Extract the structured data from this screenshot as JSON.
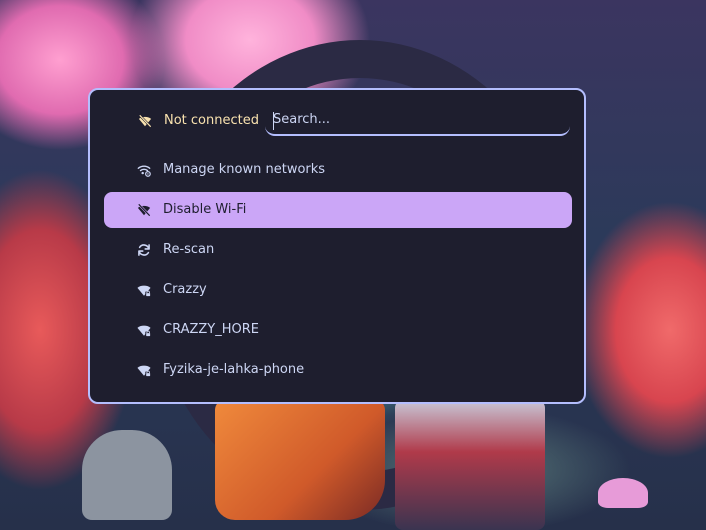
{
  "status": {
    "icon": "wifi-off-icon",
    "text": "Not connected"
  },
  "search": {
    "placeholder": "Search...",
    "value": ""
  },
  "items": [
    {
      "label": "Manage known networks",
      "icon": "wifi-settings-icon",
      "selected": false
    },
    {
      "label": "Disable Wi-Fi",
      "icon": "wifi-off-icon",
      "selected": true
    },
    {
      "label": "Re-scan",
      "icon": "refresh-icon",
      "selected": false
    },
    {
      "label": "Crazzy",
      "icon": "wifi-locked-icon",
      "selected": false
    },
    {
      "label": "CRAZZY_HORE",
      "icon": "wifi-locked-icon",
      "selected": false
    },
    {
      "label": "Fyzika-je-lahka-phone",
      "icon": "wifi-locked-icon",
      "selected": false
    }
  ],
  "colors": {
    "panel_bg": "#1e1e2e",
    "border": "#b4befe",
    "selected_bg": "#cba6f7",
    "status_text": "#f9e2af",
    "text": "#cdd6f4"
  }
}
